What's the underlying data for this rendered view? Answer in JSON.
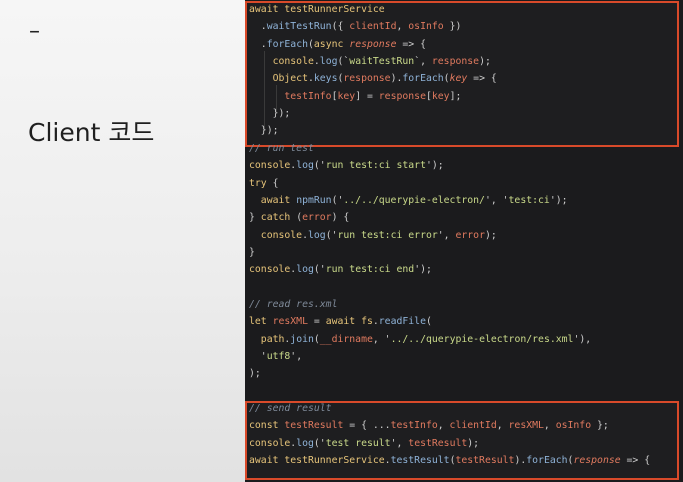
{
  "slide": {
    "dash": "–",
    "title": "Client 코드"
  },
  "colors": {
    "keyword": "#e6c47a",
    "function": "#8fb3d8",
    "string": "#c9d98a",
    "variable": "#e07a5f",
    "punct": "#cfcfcf",
    "comment": "#7f8a99",
    "param": "#e07a5f",
    "highlight_border": "#d94a2a"
  },
  "code_lines": [
    [
      [
        "await ",
        "keyword"
      ],
      [
        "testRunnerService",
        "keyword"
      ]
    ],
    [
      [
        "  .",
        "punct"
      ],
      [
        "waitTestRun",
        "function"
      ],
      [
        "({ ",
        "punct"
      ],
      [
        "clientId",
        "variable"
      ],
      [
        ", ",
        "punct"
      ],
      [
        "osInfo",
        "variable"
      ],
      [
        " })",
        "punct"
      ]
    ],
    [
      [
        "  .",
        "punct"
      ],
      [
        "forEach",
        "function"
      ],
      [
        "(",
        "punct"
      ],
      [
        "async ",
        "keyword"
      ],
      [
        "response",
        "param"
      ],
      [
        " => {",
        "punct"
      ]
    ],
    [
      [
        "    ",
        "punct"
      ],
      [
        "console",
        "keyword"
      ],
      [
        ".",
        "punct"
      ],
      [
        "log",
        "function"
      ],
      [
        "(`",
        "punct"
      ],
      [
        "waitTestRun",
        "string"
      ],
      [
        "`, ",
        "punct"
      ],
      [
        "response",
        "variable"
      ],
      [
        ");",
        "punct"
      ]
    ],
    [
      [
        "    ",
        "punct"
      ],
      [
        "Object",
        "keyword"
      ],
      [
        ".",
        "punct"
      ],
      [
        "keys",
        "function"
      ],
      [
        "(",
        "punct"
      ],
      [
        "response",
        "variable"
      ],
      [
        ").",
        "punct"
      ],
      [
        "forEach",
        "function"
      ],
      [
        "(",
        "punct"
      ],
      [
        "key",
        "param"
      ],
      [
        " => {",
        "punct"
      ]
    ],
    [
      [
        "      ",
        "punct"
      ],
      [
        "testInfo",
        "variable"
      ],
      [
        "[",
        "punct"
      ],
      [
        "key",
        "variable"
      ],
      [
        "] = ",
        "punct"
      ],
      [
        "response",
        "variable"
      ],
      [
        "[",
        "punct"
      ],
      [
        "key",
        "variable"
      ],
      [
        "];",
        "punct"
      ]
    ],
    [
      [
        "    });",
        "punct"
      ]
    ],
    [
      [
        "  });",
        "punct"
      ]
    ],
    [
      [
        "// run test",
        "comment"
      ]
    ],
    [
      [
        "console",
        "keyword"
      ],
      [
        ".",
        "punct"
      ],
      [
        "log",
        "function"
      ],
      [
        "('",
        "punct"
      ],
      [
        "run test:ci start",
        "string"
      ],
      [
        "');",
        "punct"
      ]
    ],
    [
      [
        "try ",
        "keyword"
      ],
      [
        "{",
        "punct"
      ]
    ],
    [
      [
        "  ",
        "punct"
      ],
      [
        "await ",
        "keyword"
      ],
      [
        "npmRun",
        "function"
      ],
      [
        "('",
        "punct"
      ],
      [
        "../../querypie-electron/",
        "string"
      ],
      [
        "', '",
        "punct"
      ],
      [
        "test:ci",
        "string"
      ],
      [
        "');",
        "punct"
      ]
    ],
    [
      [
        "} ",
        "punct"
      ],
      [
        "catch ",
        "keyword"
      ],
      [
        "(",
        "punct"
      ],
      [
        "error",
        "variable"
      ],
      [
        ") {",
        "punct"
      ]
    ],
    [
      [
        "  ",
        "punct"
      ],
      [
        "console",
        "keyword"
      ],
      [
        ".",
        "punct"
      ],
      [
        "log",
        "function"
      ],
      [
        "('",
        "punct"
      ],
      [
        "run test:ci error",
        "string"
      ],
      [
        "', ",
        "punct"
      ],
      [
        "error",
        "variable"
      ],
      [
        ");",
        "punct"
      ]
    ],
    [
      [
        "}",
        "punct"
      ]
    ],
    [
      [
        "console",
        "keyword"
      ],
      [
        ".",
        "punct"
      ],
      [
        "log",
        "function"
      ],
      [
        "('",
        "punct"
      ],
      [
        "run test:ci end",
        "string"
      ],
      [
        "');",
        "punct"
      ]
    ],
    [
      [
        "",
        "punct"
      ]
    ],
    [
      [
        "// read res.xml",
        "comment"
      ]
    ],
    [
      [
        "let ",
        "keyword"
      ],
      [
        "resXML",
        "variable"
      ],
      [
        " = ",
        "punct"
      ],
      [
        "await ",
        "keyword"
      ],
      [
        "fs",
        "keyword"
      ],
      [
        ".",
        "punct"
      ],
      [
        "readFile",
        "function"
      ],
      [
        "(",
        "punct"
      ]
    ],
    [
      [
        "  ",
        "punct"
      ],
      [
        "path",
        "keyword"
      ],
      [
        ".",
        "punct"
      ],
      [
        "join",
        "function"
      ],
      [
        "(",
        "punct"
      ],
      [
        "__dirname",
        "variable"
      ],
      [
        ", '",
        "punct"
      ],
      [
        "../../querypie-electron/res.xml",
        "string"
      ],
      [
        "'),",
        "punct"
      ]
    ],
    [
      [
        "  '",
        "punct"
      ],
      [
        "utf8",
        "string"
      ],
      [
        "',",
        "punct"
      ]
    ],
    [
      [
        ");",
        "punct"
      ]
    ],
    [
      [
        "",
        "punct"
      ]
    ],
    [
      [
        "// send result",
        "comment"
      ]
    ],
    [
      [
        "const ",
        "keyword"
      ],
      [
        "testResult",
        "variable"
      ],
      [
        " = { ...",
        "punct"
      ],
      [
        "testInfo",
        "variable"
      ],
      [
        ", ",
        "punct"
      ],
      [
        "clientId",
        "variable"
      ],
      [
        ", ",
        "punct"
      ],
      [
        "resXML",
        "variable"
      ],
      [
        ", ",
        "punct"
      ],
      [
        "osInfo",
        "variable"
      ],
      [
        " };",
        "punct"
      ]
    ],
    [
      [
        "console",
        "keyword"
      ],
      [
        ".",
        "punct"
      ],
      [
        "log",
        "function"
      ],
      [
        "('",
        "punct"
      ],
      [
        "test result",
        "string"
      ],
      [
        "', ",
        "punct"
      ],
      [
        "testResult",
        "variable"
      ],
      [
        ");",
        "punct"
      ]
    ],
    [
      [
        "await ",
        "keyword"
      ],
      [
        "testRunnerService",
        "keyword"
      ],
      [
        ".",
        "punct"
      ],
      [
        "testResult",
        "function"
      ],
      [
        "(",
        "punct"
      ],
      [
        "testResult",
        "variable"
      ],
      [
        ").",
        "punct"
      ],
      [
        "forEach",
        "function"
      ],
      [
        "(",
        "punct"
      ],
      [
        "response",
        "param"
      ],
      [
        " => {",
        "punct"
      ]
    ]
  ]
}
